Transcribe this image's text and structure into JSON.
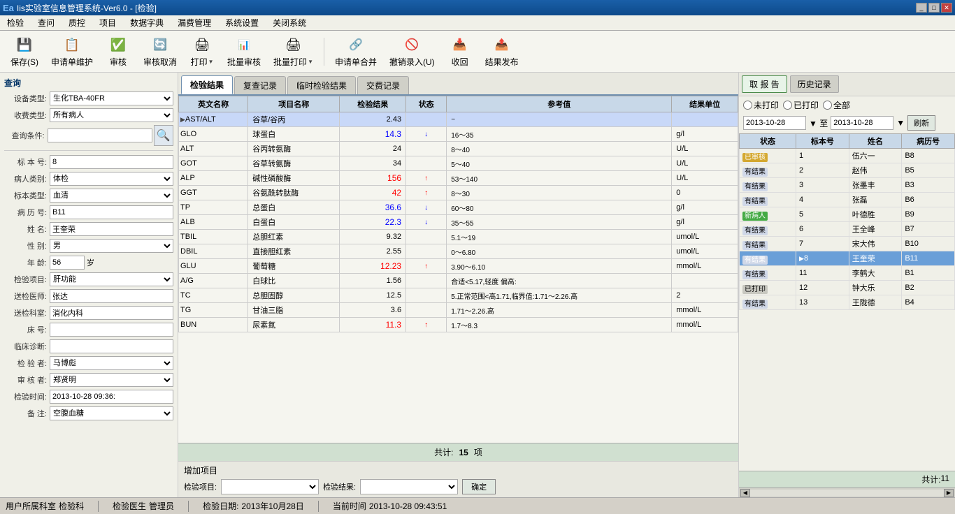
{
  "window": {
    "title": "Iis实验室信息管理系统-Ver6.0 - [检验]",
    "logo_text": "Ea"
  },
  "menu": {
    "items": [
      "检验",
      "查问",
      "质控",
      "项目",
      "数据字典",
      "漏费管理",
      "系统设置",
      "关闭系统"
    ]
  },
  "toolbar": {
    "buttons": [
      {
        "label": "保存(S)",
        "icon": "💾"
      },
      {
        "label": "申请单维护",
        "icon": "📋"
      },
      {
        "label": "审核",
        "icon": "✅"
      },
      {
        "label": "审核取消",
        "icon": "🔄"
      },
      {
        "label": "打印",
        "icon": "🖨"
      },
      {
        "label": "批量审核",
        "icon": "📊"
      },
      {
        "label": "批量打印",
        "icon": "🖨"
      },
      {
        "label": "申请单合并",
        "icon": "🔗"
      },
      {
        "label": "撤销录入(U)",
        "icon": "🚫"
      },
      {
        "label": "收回",
        "icon": "📥"
      },
      {
        "label": "结果发布",
        "icon": "📤"
      }
    ]
  },
  "left_panel": {
    "query_label": "查询",
    "device_label": "设备类型:",
    "device_value": "生化TBA-40FR",
    "collect_label": "收费类型:",
    "collect_value": "所有病人",
    "query_condition_label": "查询条件:",
    "query_condition_value": "",
    "sample_no_label": "标 本 号:",
    "sample_no_value": "8",
    "patient_type_label": "病人类别:",
    "patient_type_value": "体检",
    "sample_type_label": "标本类型:",
    "sample_type_value": "血清",
    "case_no_label": "病 历 号:",
    "case_no_value": "B11",
    "name_label": "姓    名:",
    "name_value": "王奎荣",
    "gender_label": "性    别:",
    "gender_value": "男",
    "age_label": "年    龄:",
    "age_value": "56",
    "age_unit": "岁",
    "exam_item_label": "检验项目:",
    "exam_item_value": "肝功能",
    "doctor_label": "送检医师:",
    "doctor_value": "张达",
    "dept_label": "送检科室:",
    "dept_value": "消化内科",
    "bed_label": "床    号:",
    "bed_value": "",
    "diagnosis_label": "临床诊断:",
    "diagnosis_value": "",
    "examiner_label": "检 验 者:",
    "examiner_value": "马博彪",
    "auditor_label": "审 核 者:",
    "auditor_value": "郑贤明",
    "exam_time_label": "检验时间:",
    "exam_time_value": "2013-10-28 09:36:",
    "remark_label": "备    注:",
    "remark_value": "空腹血糖"
  },
  "main_tabs": [
    {
      "label": "检验结果",
      "active": true
    },
    {
      "label": "复查记录"
    },
    {
      "label": "临时检验结果"
    },
    {
      "label": "交费记录"
    }
  ],
  "results_table": {
    "headers": [
      "英文名称",
      "项目名称",
      "检验结果",
      "状态",
      "参考值",
      "结果单位"
    ],
    "rows": [
      {
        "en": "AST/ALT",
        "cn": "谷草/谷丙",
        "value": "2.43",
        "status": "",
        "ref": "~",
        "unit": "",
        "selected": true
      },
      {
        "en": "GLO",
        "cn": "球蛋白",
        "value": "14.3",
        "status": "↓",
        "ref": "16～35",
        "unit": "g/l",
        "low": true
      },
      {
        "en": "ALT",
        "cn": "谷丙转氨酶",
        "value": "24",
        "status": "",
        "ref": "8～40",
        "unit": "U/L"
      },
      {
        "en": "GOT",
        "cn": "谷草转氨酶",
        "value": "34",
        "status": "",
        "ref": "5～40",
        "unit": "U/L"
      },
      {
        "en": "ALP",
        "cn": "碱性磷酸酶",
        "value": "156",
        "status": "↑",
        "ref": "53～140",
        "unit": "U/L",
        "high": true
      },
      {
        "en": "GGT",
        "cn": "谷氨酰转肽酶",
        "value": "42",
        "status": "↑",
        "ref": "8～30",
        "unit": "0",
        "high": true
      },
      {
        "en": "TP",
        "cn": "总蛋白",
        "value": "36.6",
        "status": "↓",
        "ref": "60～80",
        "unit": "g/l",
        "low": true
      },
      {
        "en": "ALB",
        "cn": "白蛋白",
        "value": "22.3",
        "status": "↓",
        "ref": "35～55",
        "unit": "g/l",
        "low": true
      },
      {
        "en": "TBIL",
        "cn": "总胆红素",
        "value": "9.32",
        "status": "",
        "ref": "5.1～19",
        "unit": "umol/L"
      },
      {
        "en": "DBIL",
        "cn": "直接胆红素",
        "value": "2.55",
        "status": "",
        "ref": "0～6.80",
        "unit": "umol/L"
      },
      {
        "en": "GLU",
        "cn": "葡萄糖",
        "value": "12.23",
        "status": "↑",
        "ref": "3.90～6.10",
        "unit": "mmol/L",
        "high": true
      },
      {
        "en": "A/G",
        "cn": "白球比",
        "value": "1.56",
        "status": "",
        "ref": "合适<5.17,轻度 偏高:",
        "unit": ""
      },
      {
        "en": "TC",
        "cn": "总胆固醇",
        "value": "12.5",
        "status": "",
        "ref": "5.正常范围<高1.71,临界值:1.71～2.26.高",
        "unit": "2"
      },
      {
        "en": "TG",
        "cn": "甘油三脂",
        "value": "3.6",
        "status": "",
        "ref": "1.71～2.26.高",
        "unit": "mmol/L"
      },
      {
        "en": "BUN",
        "cn": "尿素氮",
        "value": "11.3",
        "status": "↑",
        "ref": "1.7～8.3",
        "unit": "mmol/L",
        "high": true
      }
    ],
    "footer_label": "共计:",
    "footer_count": "15",
    "footer_unit": "项"
  },
  "add_item": {
    "label": "增加项目",
    "exam_item_label": "检验项目:",
    "exam_result_label": "检验结果:",
    "confirm_label": "确定"
  },
  "right_panel": {
    "tabs": [
      {
        "label": "取 报 告",
        "active": true
      },
      {
        "label": "历史记录"
      }
    ],
    "radio_options": [
      {
        "label": "未打印",
        "name": "print_status"
      },
      {
        "label": "已打印",
        "name": "print_status"
      },
      {
        "label": "全部",
        "name": "print_status",
        "checked": false
      }
    ],
    "date_from": "2013-10-28",
    "date_to": "2013-10-28",
    "refresh_label": "刷新",
    "table_headers": [
      "状态",
      "标本号",
      "姓名",
      "病历号"
    ],
    "patients": [
      {
        "status": "已审核",
        "status_type": "yishenhe",
        "id": "1",
        "name": "伍六一",
        "case": "B8"
      },
      {
        "status": "有结果",
        "status_type": "youjieguo",
        "id": "2",
        "name": "赵伟",
        "case": "B5"
      },
      {
        "status": "有结果",
        "status_type": "youjieguo",
        "id": "3",
        "name": "张墨丰",
        "case": "B3"
      },
      {
        "status": "有结果",
        "status_type": "youjieguo",
        "id": "4",
        "name": "张磊",
        "case": "B6"
      },
      {
        "status": "新病人",
        "status_type": "xinbingren",
        "id": "5",
        "name": "叶德胜",
        "case": "B9"
      },
      {
        "status": "有结果",
        "status_type": "youjieguo",
        "id": "6",
        "name": "王全峰",
        "case": "B7"
      },
      {
        "status": "有结果",
        "status_type": "youjieguo",
        "id": "7",
        "name": "宋大伟",
        "case": "B10"
      },
      {
        "status": "有结果",
        "status_type": "youjieguo",
        "id": "8",
        "name": "王奎荣",
        "case": "B11",
        "selected": true
      },
      {
        "status": "有结果",
        "status_type": "youjieguo",
        "id": "11",
        "name": "李鹤大",
        "case": "B1"
      },
      {
        "status": "已打印",
        "status_type": "yidayin",
        "id": "12",
        "name": "钟大乐",
        "case": "B2"
      },
      {
        "status": "有结果",
        "status_type": "youjieguo",
        "id": "13",
        "name": "王陇德",
        "case": "B4"
      }
    ],
    "total_label": "共计:",
    "total_count": "11"
  },
  "status_bar": {
    "dept_label": "用户所属科室",
    "dept_value": "检验科",
    "role_label": "检验医生",
    "role_value": "管理员",
    "exam_date_label": "检验日期:",
    "exam_date_value": "2013年10月28日",
    "current_time_label": "当前时间",
    "current_time_value": "2013-10-28 09:43:51"
  }
}
